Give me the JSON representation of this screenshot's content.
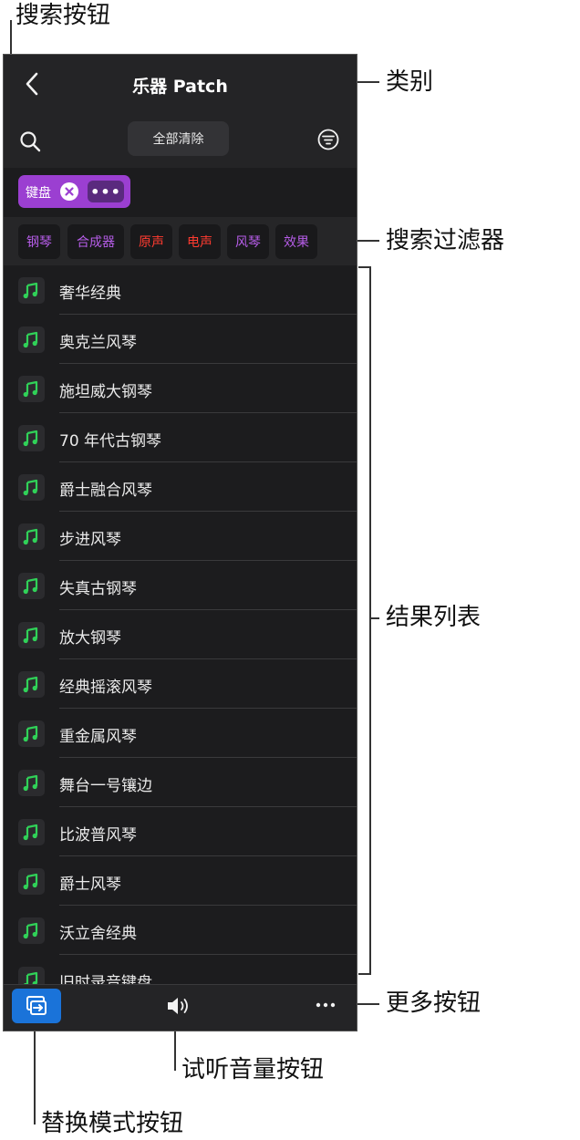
{
  "callouts": {
    "search_button": "搜索按钮",
    "category": "类别",
    "search_filter": "搜索过滤器",
    "results_list": "结果列表",
    "more_button": "更多按钮",
    "preview_volume_button": "试听音量按钮",
    "replace_mode_button": "替换模式按钮"
  },
  "header": {
    "title": "乐器 Patch",
    "clear_all": "全部清除"
  },
  "tag": {
    "label": "键盘",
    "more": "•••"
  },
  "filters": [
    {
      "label": "钢琴",
      "color": "#b65de8"
    },
    {
      "label": "合成器",
      "color": "#b65de8"
    },
    {
      "label": "原声",
      "color": "#ff3b30"
    },
    {
      "label": "电声",
      "color": "#ff3b30"
    },
    {
      "label": "风琴",
      "color": "#b65de8"
    },
    {
      "label": "效果",
      "color": "#b65de8"
    }
  ],
  "results": [
    "奢华经典",
    "奥克兰风琴",
    "施坦威大钢琴",
    "70 年代古钢琴",
    "爵士融合风琴",
    "步进风琴",
    "失真古钢琴",
    "放大钢琴",
    "经典摇滚风琴",
    "重金属风琴",
    "舞台一号镶边",
    "比波普风琴",
    "爵士风琴",
    "沃立舍经典",
    "旧时录音键盘"
  ],
  "colors": {
    "accent_purple": "#9b3fd1",
    "accent_blue": "#1a73d9",
    "note_green": "#30d158"
  },
  "icons": {
    "note": "music-note-icon"
  }
}
